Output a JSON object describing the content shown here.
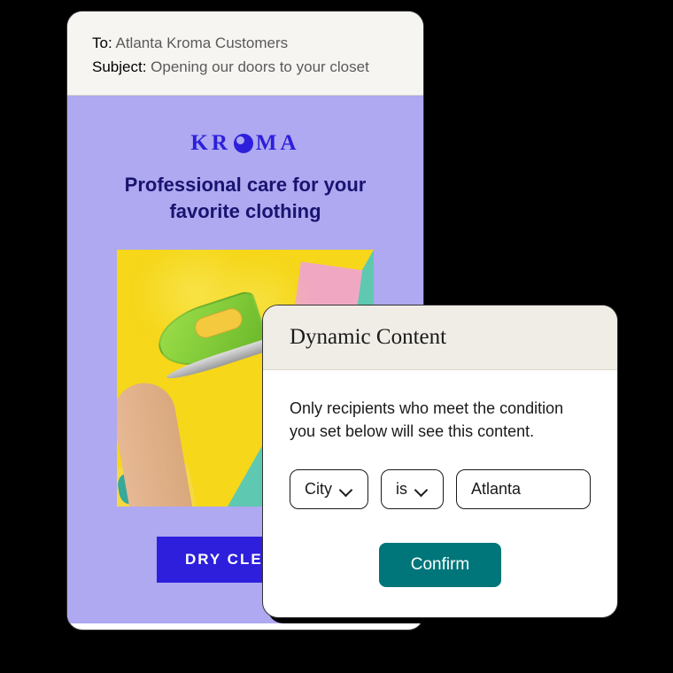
{
  "email": {
    "header": {
      "to_label": "To:",
      "to_value": "Atlanta Kroma Customers",
      "subject_label": "Subject:",
      "subject_value": "Opening our doors to your closet"
    },
    "body": {
      "brand_left": "KR",
      "brand_right": "MA",
      "headline": "Professional care for your favorite clothing",
      "cta_label": "DRY CLEAN Y"
    }
  },
  "modal": {
    "title": "Dynamic Content",
    "description": "Only recipients who meet the condition you set below will see this content.",
    "condition": {
      "field": "City",
      "operator": "is",
      "value": "Atlanta"
    },
    "confirm_label": "Confirm"
  }
}
